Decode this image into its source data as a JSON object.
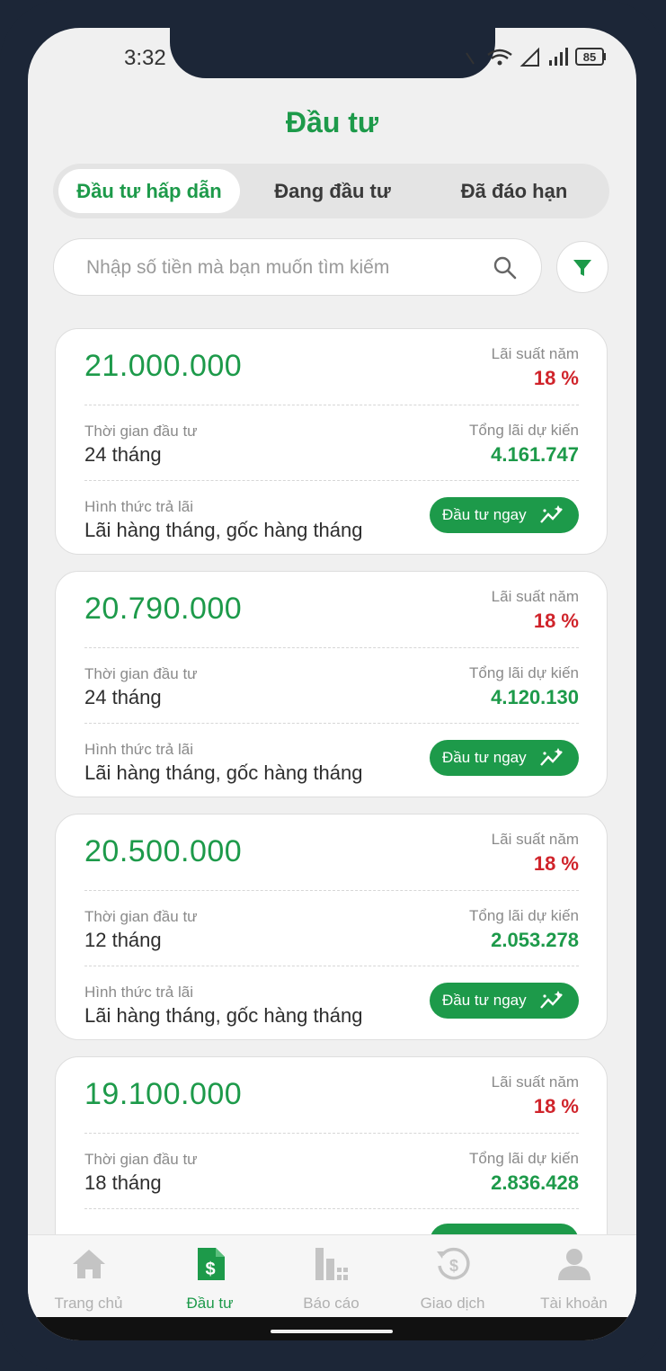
{
  "status_bar": {
    "time": "3:32",
    "battery": "85"
  },
  "header": {
    "title": "Đầu tư"
  },
  "tabs": [
    {
      "label": "Đầu tư hấp dẫn",
      "active": true
    },
    {
      "label": "Đang đầu tư",
      "active": false
    },
    {
      "label": "Đã đáo hạn",
      "active": false
    }
  ],
  "search": {
    "placeholder": "Nhập số tiền mà bạn muốn tìm kiếm",
    "value": ""
  },
  "cards": [
    {
      "amount": "21.000.000",
      "rate_label": "Lãi suất năm",
      "rate": "18 %",
      "term_label": "Thời gian đầu tư",
      "term": "24 tháng",
      "interest_label": "Tổng lãi dự kiến",
      "interest": "4.161.747",
      "method_label": "Hình thức trả lãi",
      "method": "Lãi hàng tháng, gốc hàng tháng",
      "button": "Đầu tư ngay"
    },
    {
      "amount": "20.790.000",
      "rate_label": "Lãi suất năm",
      "rate": "18 %",
      "term_label": "Thời gian đầu tư",
      "term": "24 tháng",
      "interest_label": "Tổng lãi dự kiến",
      "interest": "4.120.130",
      "method_label": "Hình thức trả lãi",
      "method": "Lãi hàng tháng, gốc hàng tháng",
      "button": "Đầu tư ngay"
    },
    {
      "amount": "20.500.000",
      "rate_label": "Lãi suất năm",
      "rate": "18 %",
      "term_label": "Thời gian đầu tư",
      "term": "12 tháng",
      "interest_label": "Tổng lãi dự kiến",
      "interest": "2.053.278",
      "method_label": "Hình thức trả lãi",
      "method": "Lãi hàng tháng, gốc hàng tháng",
      "button": "Đầu tư ngay"
    },
    {
      "amount": "19.100.000",
      "rate_label": "Lãi suất năm",
      "rate": "18 %",
      "term_label": "Thời gian đầu tư",
      "term": "18 tháng",
      "interest_label": "Tổng lãi dự kiến",
      "interest": "2.836.428",
      "method_label": "Hình thức trả lãi",
      "method": "",
      "button": ""
    }
  ],
  "bottom_nav": [
    {
      "label": "Trang chủ",
      "icon": "home-icon",
      "active": false
    },
    {
      "label": "Đầu tư",
      "icon": "invest-document-icon",
      "active": true
    },
    {
      "label": "Báo cáo",
      "icon": "report-bars-icon",
      "active": false
    },
    {
      "label": "Giao dịch",
      "icon": "transaction-dollar-icon",
      "active": false
    },
    {
      "label": "Tài khoản",
      "icon": "account-user-icon",
      "active": false
    }
  ],
  "colors": {
    "primary": "#1d9a4a",
    "rate": "#d0242b",
    "frame": "#1c2637"
  }
}
